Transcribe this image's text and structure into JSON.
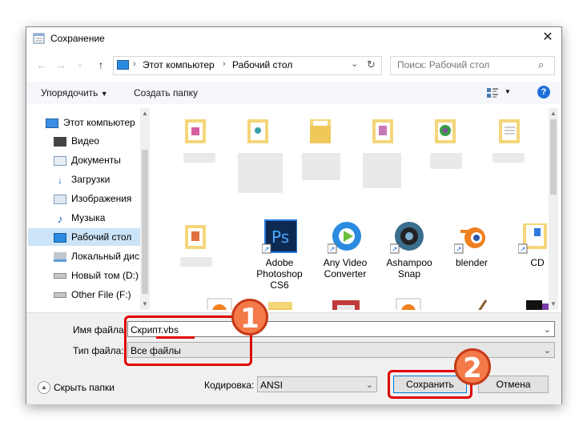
{
  "window": {
    "title": "Сохранение"
  },
  "address": {
    "path_root": "Этот компьютер",
    "path_current": "Рабочий стол",
    "search_placeholder": "Поиск: Рабочий стол"
  },
  "toolbar": {
    "organize_label": "Упорядочить",
    "new_folder_label": "Создать папку"
  },
  "sidebar": {
    "items": [
      {
        "label": "Этот компьютер"
      },
      {
        "label": "Видео"
      },
      {
        "label": "Документы"
      },
      {
        "label": "Загрузки"
      },
      {
        "label": "Изображения"
      },
      {
        "label": "Музыка"
      },
      {
        "label": "Рабочий стол"
      },
      {
        "label": "Локальный дис"
      },
      {
        "label": "Новый том (D:)"
      },
      {
        "label": "Other File (F:)"
      }
    ]
  },
  "files": {
    "row2": [
      {
        "label": "Adobe Photoshop CS6"
      },
      {
        "label": "Any Video Converter"
      },
      {
        "label": "Ashampoo Snap"
      },
      {
        "label": "blender"
      },
      {
        "label": "CD"
      }
    ]
  },
  "form": {
    "filename_label": "Имя файла:",
    "filename_value": "Скрипт.vbs",
    "filetype_label": "Тип файла:",
    "filetype_value": "Все файлы",
    "encoding_label": "Кодировка:",
    "encoding_value": "ANSI"
  },
  "buttons": {
    "hide_folders": "Скрыть папки",
    "save": "Сохранить",
    "cancel": "Отмена"
  },
  "annotations": {
    "badge1": "1",
    "badge2": "2"
  },
  "colors": {
    "highlight_red": "#e00000",
    "badge_orange": "#f47a4a",
    "selection_blue": "#cce4f7"
  }
}
